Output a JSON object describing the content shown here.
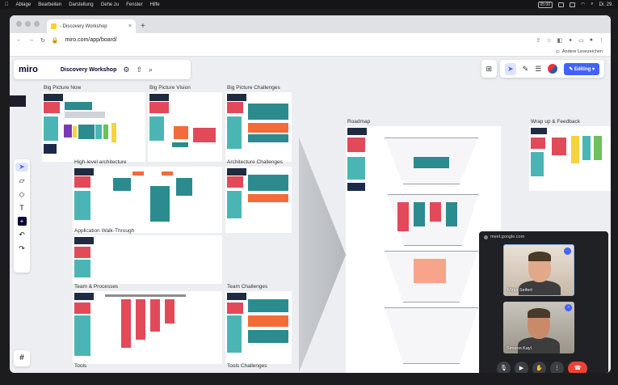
{
  "menubar": {
    "items": [
      "Ablage",
      "Bearbeiten",
      "Darstellung",
      "Gehe zu",
      "Fenster",
      "Hilfe"
    ],
    "time": "05:00",
    "date": "Di. 29."
  },
  "browser": {
    "tab_title": "- Discovery Workshop",
    "url": "miro.com/app/board/",
    "bookmarks_label": "Andere Lesezeichen"
  },
  "miro": {
    "logo": "miro",
    "board_name": "Discovery Workshop",
    "editing_label": "Editing"
  },
  "frames": {
    "big_picture_now": "Big Picture Now",
    "big_picture_vision": "Big Picture Vision",
    "big_picture_challenges": "Big Picture Challenges",
    "high_level_architecture": "High-level architecture",
    "architecture_challenges": "Architecture Challenges",
    "application_walkthrough": "Application Walk-Through",
    "team_processes": "Team & Processes",
    "team_challenges": "Team Challenges",
    "tools": "Tools",
    "tools_challenges": "Tools Challenges",
    "roadmap": "Roadmap",
    "wrapup": "Wrap up & Feedback"
  },
  "meet": {
    "title": "meet.google.com",
    "participants": [
      "Mirko Seifert",
      "Simeon Kayl"
    ]
  },
  "colors": {
    "accent": "#4262ff",
    "red": "#e24a5a",
    "teal": "#4bb5b5",
    "navy": "#1a2a4b",
    "orange": "#f26b3a"
  }
}
